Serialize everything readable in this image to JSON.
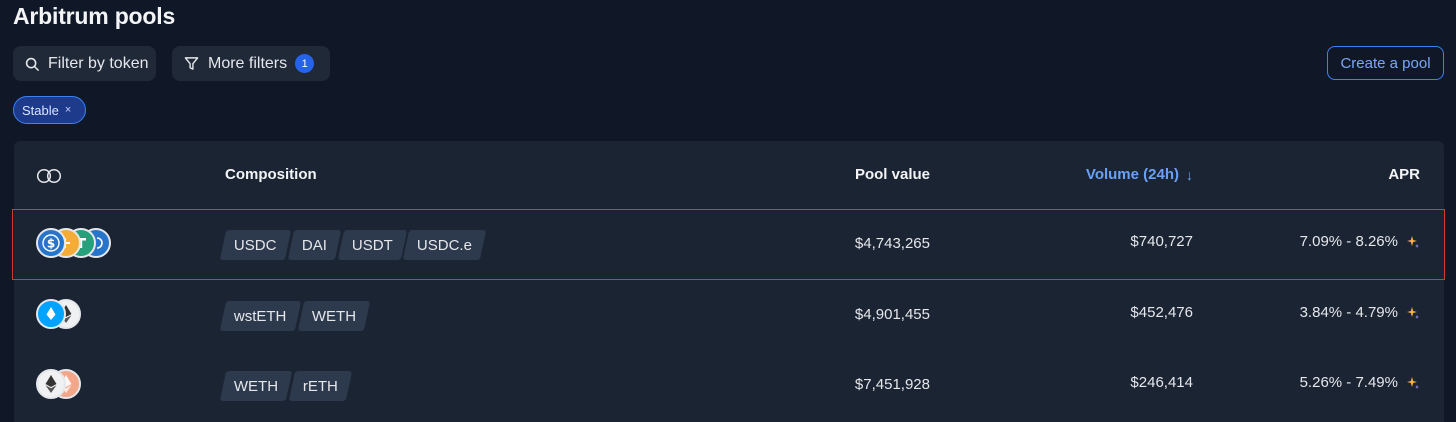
{
  "header": {
    "title": "Arbitrum pools"
  },
  "toolbar": {
    "filter_by_token": "Filter by token",
    "more_filters": "More filters",
    "filters_count": "1",
    "create_pool": "Create a pool"
  },
  "chips": [
    {
      "label": "Stable",
      "remove": "×"
    }
  ],
  "table": {
    "columns": {
      "composition": "Composition",
      "pool_value": "Pool value",
      "volume": "Volume (24h)",
      "volume_sort_arrow": "↓",
      "apr": "APR"
    },
    "rows": [
      {
        "token_icons": [
          "usdc-icon",
          "dai-icon",
          "usdt-icon",
          "usdc-e-icon"
        ],
        "composition": [
          "USDC",
          "DAI",
          "USDT",
          "USDC.e"
        ],
        "pool_value": "$4,743,265",
        "volume": "$740,727",
        "apr": "7.09% - 8.26%"
      },
      {
        "token_icons": [
          "wsteth-icon",
          "weth-icon"
        ],
        "composition": [
          "wstETH",
          "WETH"
        ],
        "pool_value": "$4,901,455",
        "volume": "$452,476",
        "apr": "3.84% - 4.79%"
      },
      {
        "token_icons": [
          "weth-icon",
          "reth-icon"
        ],
        "composition": [
          "WETH",
          "rETH"
        ],
        "pool_value": "$7,451,928",
        "volume": "$246,414",
        "apr": "5.26% - 7.49%"
      }
    ]
  },
  "colors": {
    "background": "#101827",
    "table_bg": "#1b2433",
    "accent_blue": "#3b82f6",
    "highlight_border": "#d13c2f",
    "sparkle": "#f5b043"
  }
}
